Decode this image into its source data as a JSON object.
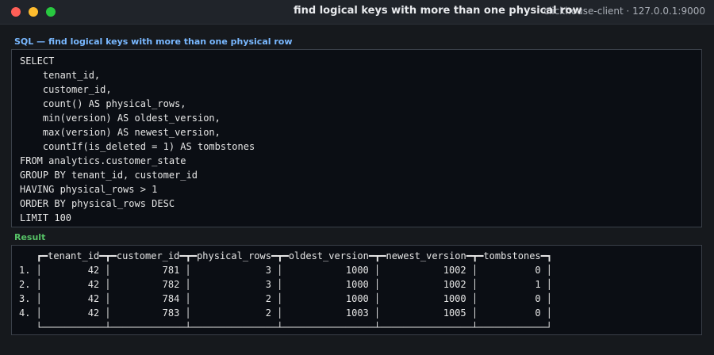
{
  "window": {
    "title": "find logical keys with more than one physical row",
    "host": "clickhouse-client · 127.0.0.1:9000"
  },
  "sql_section": {
    "label": "SQL — find logical keys with more than one physical row",
    "lines": [
      "SELECT",
      "    tenant_id,",
      "    customer_id,",
      "    count() AS physical_rows,",
      "    min(version) AS oldest_version,",
      "    max(version) AS newest_version,",
      "    countIf(is_deleted = 1) AS tombstones",
      "FROM analytics.customer_state",
      "GROUP BY tenant_id, customer_id",
      "HAVING physical_rows > 1",
      "ORDER BY physical_rows DESC",
      "LIMIT 100"
    ]
  },
  "result_section": {
    "label": "Result",
    "columns": [
      "tenant_id",
      "customer_id",
      "physical_rows",
      "oldest_version",
      "newest_version",
      "tombstones"
    ],
    "rows": [
      {
        "num": "1.",
        "cells": [
          "42",
          "781",
          "3",
          "1000",
          "1002",
          "0"
        ]
      },
      {
        "num": "2.",
        "cells": [
          "42",
          "782",
          "3",
          "1000",
          "1002",
          "1"
        ]
      },
      {
        "num": "3.",
        "cells": [
          "42",
          "784",
          "2",
          "1000",
          "1000",
          "0"
        ]
      },
      {
        "num": "4.",
        "cells": [
          "42",
          "783",
          "2",
          "1003",
          "1005",
          "0"
        ]
      }
    ]
  },
  "colors": {
    "sql_label": "#79b8ff",
    "result_label": "#56c266",
    "panel_bg": "#0b0e14",
    "window_bg": "#16191d"
  }
}
